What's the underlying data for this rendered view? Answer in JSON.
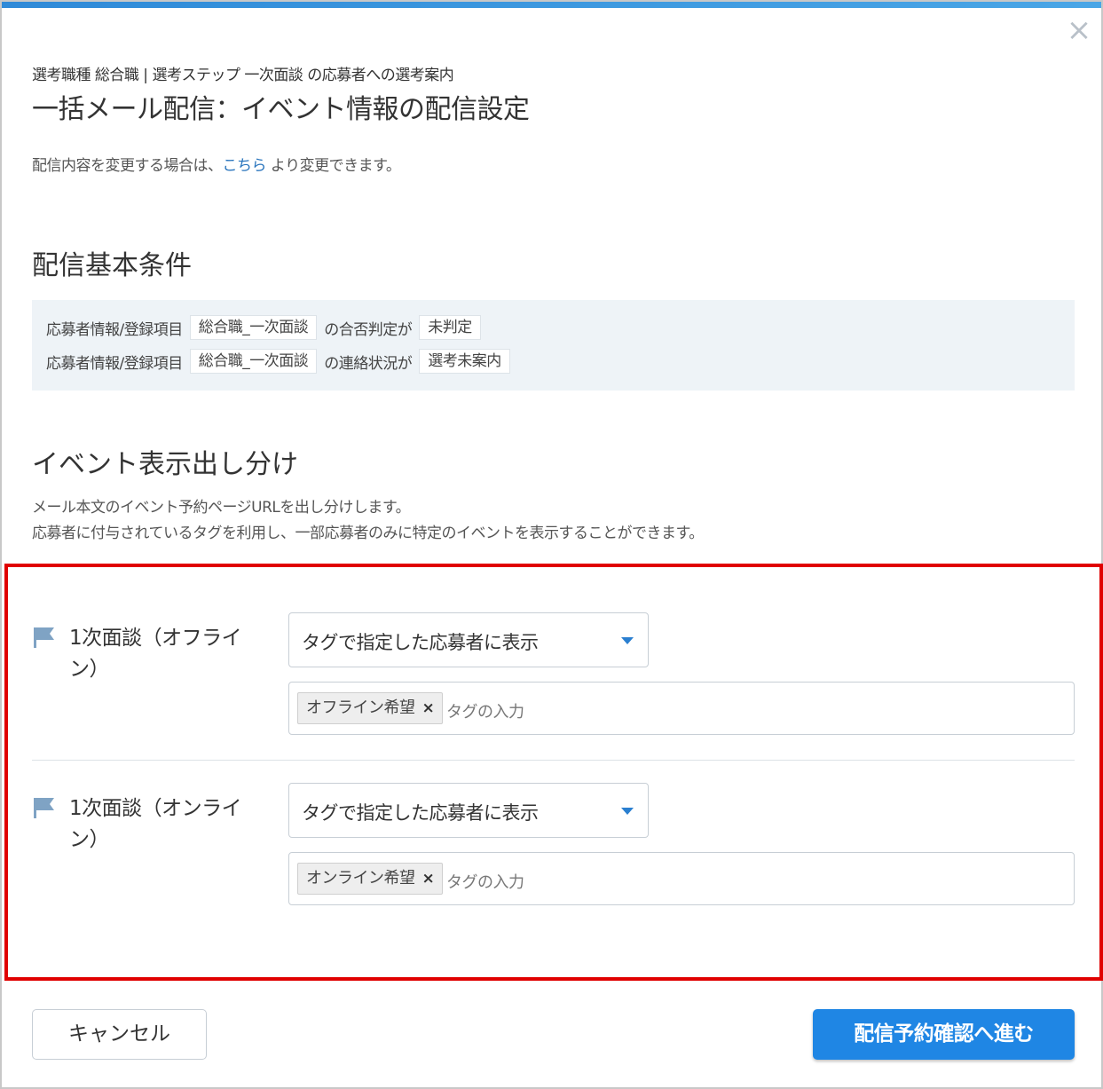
{
  "dialog": {
    "close_icon": "close-icon",
    "accent_color": "#2f8ad8"
  },
  "header": {
    "breadcrumb": "選考職種 総合職 | 選考ステップ 一次面談 の応募者への選考案内",
    "title": "一括メール配信：イベント情報の配信設定"
  },
  "intro": {
    "before": "配信内容を変更する場合は、",
    "link": "こちら",
    "after": " より変更できます。"
  },
  "basic_conditions": {
    "title": "配信基本条件",
    "rows": [
      {
        "field": "応募者情報/登録項目",
        "item": "総合職_一次面談",
        "predicate": "の合否判定が",
        "value": "未判定"
      },
      {
        "field": "応募者情報/登録項目",
        "item": "総合職_一次面談",
        "predicate": "の連絡状況が",
        "value": "選考未案内"
      }
    ]
  },
  "event_display": {
    "title": "イベント表示出し分け",
    "desc_line1": "メール本文のイベント予約ページURLを出し分けします。",
    "desc_line2": "応募者に付与されているタグを利用し、一部応募者のみに特定のイベントを表示することができます。",
    "events": [
      {
        "name": "1次面談（オフライン）",
        "select_value": "タグで指定した応募者に表示",
        "tag": "オフライン希望",
        "tag_remove": "×",
        "placeholder": "タグの入力"
      },
      {
        "name": "1次面談（オンライン）",
        "select_value": "タグで指定した応募者に表示",
        "tag": "オンライン希望",
        "tag_remove": "×",
        "placeholder": "タグの入力"
      }
    ],
    "highlight_color": "#e00000"
  },
  "footer": {
    "cancel_label": "キャンセル",
    "submit_label": "配信予約確認へ進む",
    "submit_color": "#1f86e4"
  }
}
